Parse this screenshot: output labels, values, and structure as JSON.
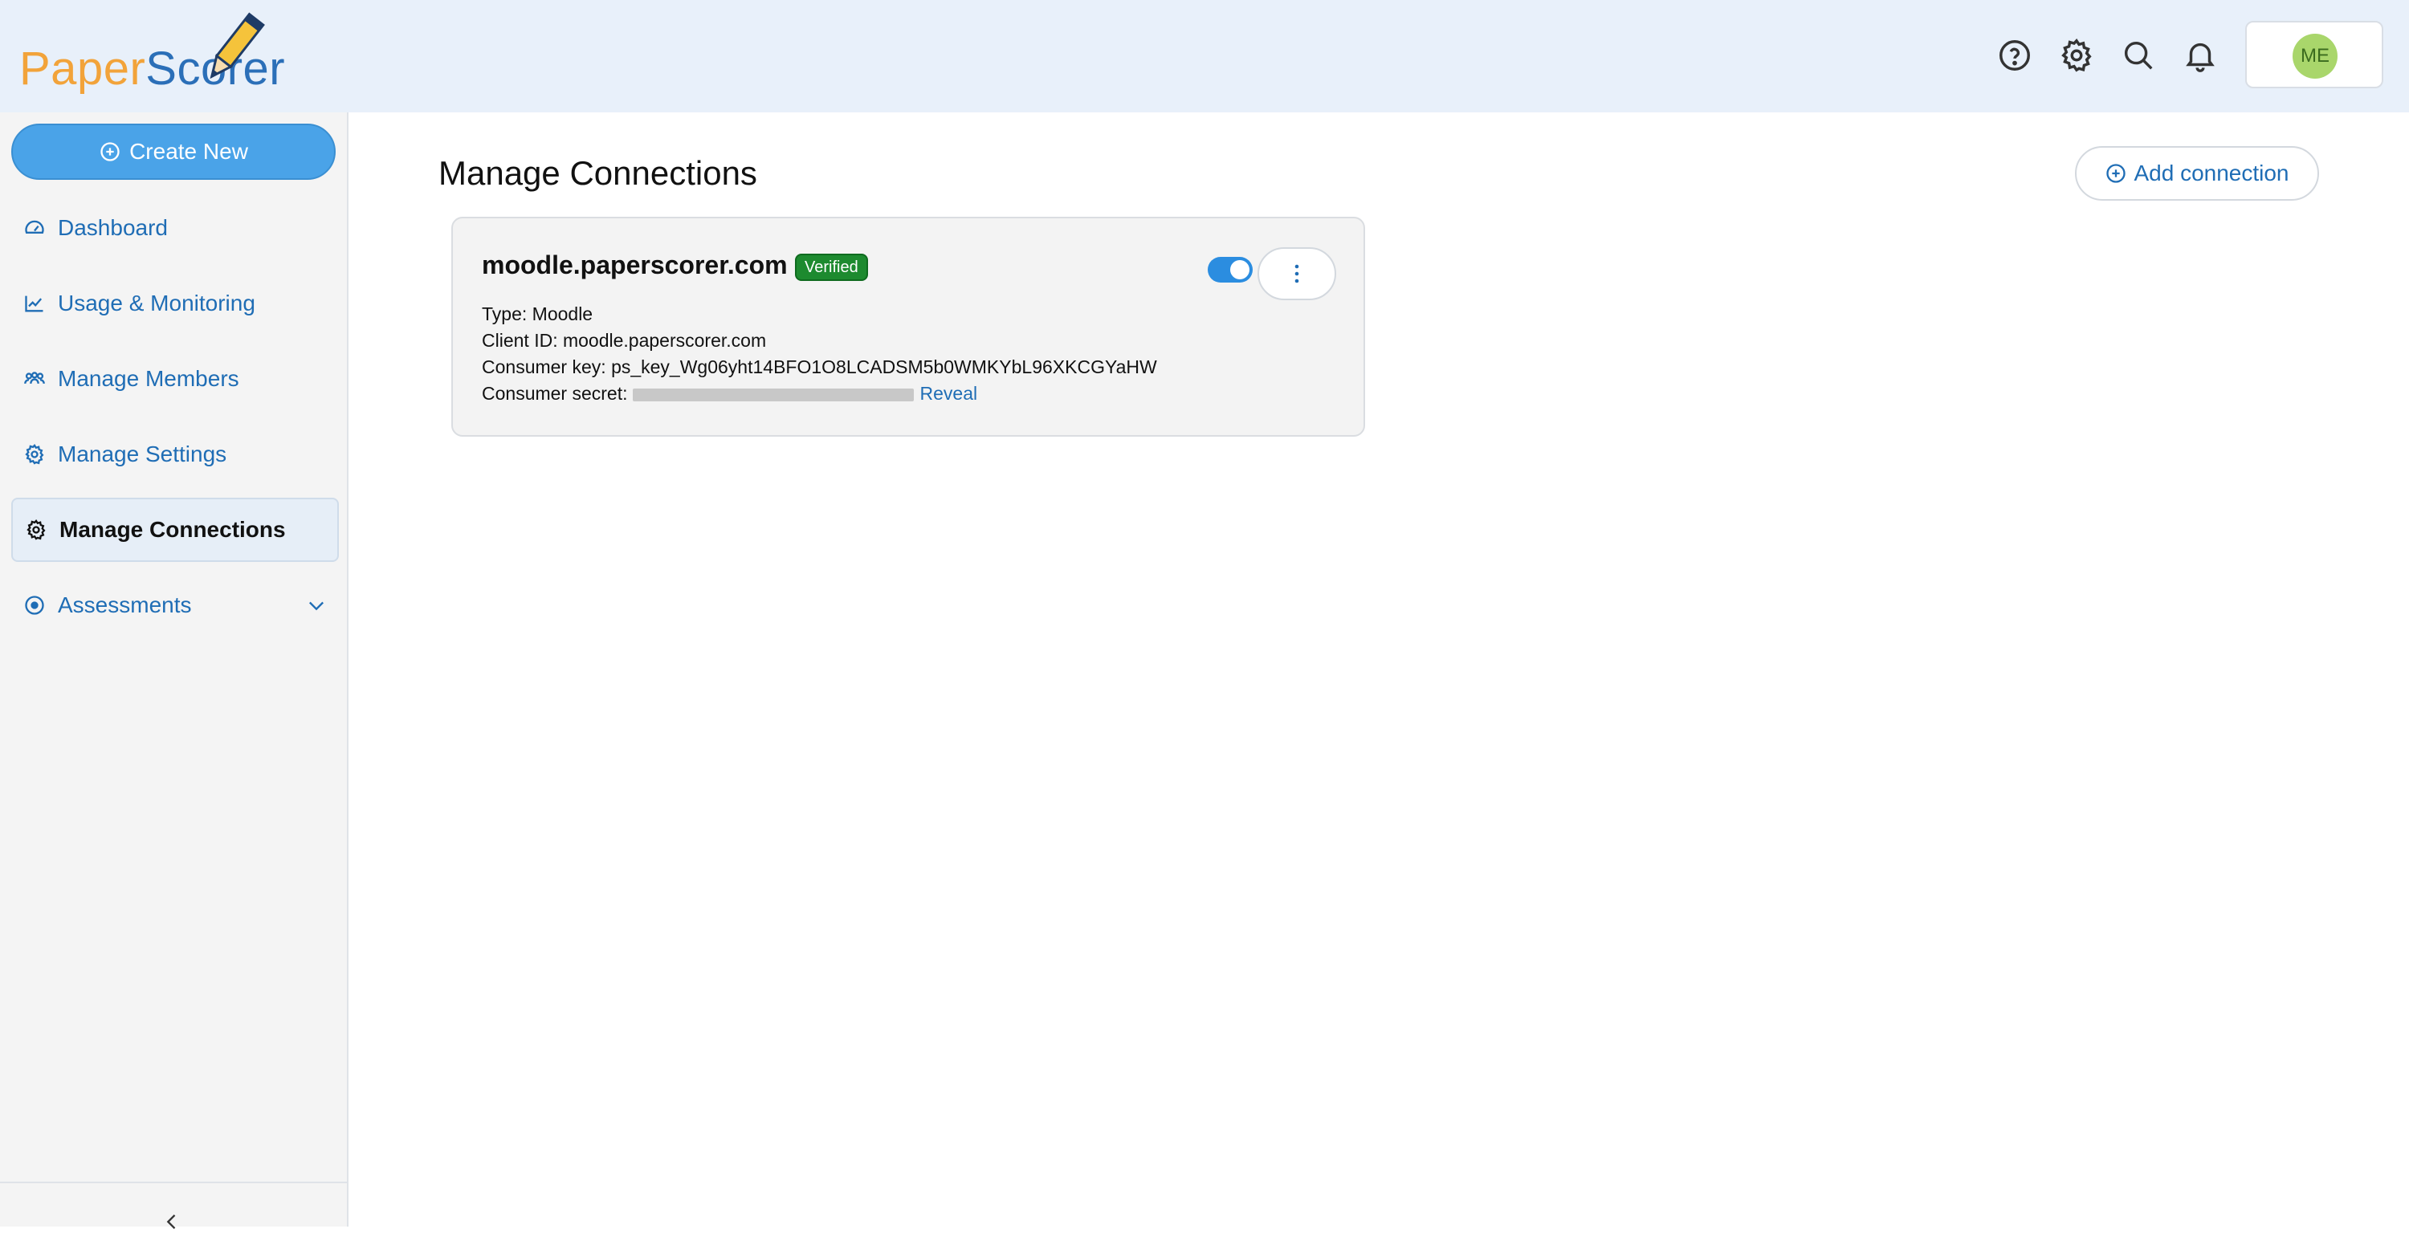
{
  "brand": {
    "part1": "Paper",
    "part2": "Scorer",
    "logo_icon": "pencil-icon"
  },
  "header": {
    "icons": [
      "help-circle-icon",
      "gear-icon",
      "search-icon",
      "bell-icon"
    ],
    "user_initials": "ME"
  },
  "sidebar": {
    "create_label": "Create New",
    "items": [
      {
        "label": "Dashboard",
        "icon": "gauge-icon"
      },
      {
        "label": "Usage & Monitoring",
        "icon": "line-chart-icon"
      },
      {
        "label": "Manage Members",
        "icon": "users-icon"
      },
      {
        "label": "Manage Settings",
        "icon": "gear-icon"
      },
      {
        "label": "Manage Connections",
        "icon": "gear-icon",
        "active": true
      },
      {
        "label": "Assessments",
        "icon": "target-icon"
      }
    ]
  },
  "main": {
    "title": "Manage Connections",
    "add_label": "Add connection",
    "connection": {
      "name": "moodle.paperscorer.com",
      "badge": "Verified",
      "enabled": true,
      "type_label": "Type:",
      "type_value": "Moodle",
      "client_id_label": "Client ID:",
      "client_id_value": "moodle.paperscorer.com",
      "consumer_key_label": "Consumer key:",
      "consumer_key_value": "ps_key_Wg06yht14BFO1O8LCADSM5b0WMKYbL96XKCGYaHW",
      "consumer_secret_label": "Consumer secret:",
      "reveal_label": "Reveal"
    }
  },
  "colors": {
    "header_bg": "#e8f0fa",
    "primary": "#4aa3e8",
    "link": "#1f6db5",
    "verified": "#1d8a2f",
    "logo_orange": "#f2a33a",
    "logo_blue": "#2b6fb8"
  }
}
